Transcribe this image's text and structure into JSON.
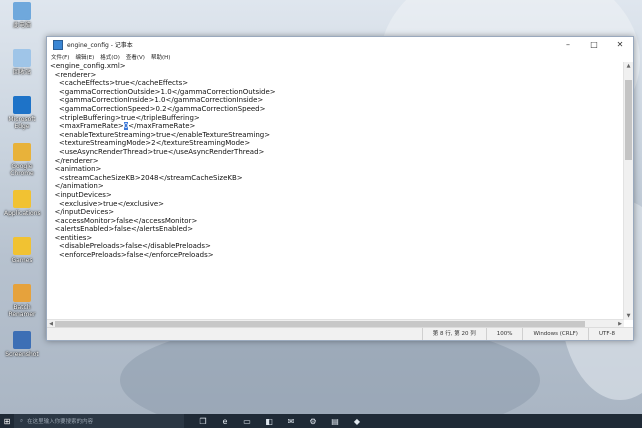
{
  "desktop": {
    "icons": [
      {
        "label": "此电脑",
        "icon": "computer-icon",
        "color": "#6fa8dc"
      },
      {
        "label": "回收站",
        "icon": "recycle-bin-icon",
        "color": "#9fc5e8"
      },
      {
        "label": "Microsoft Edge",
        "icon": "edge-icon",
        "color": "#1e73c8"
      },
      {
        "label": "Google Chrome",
        "icon": "chrome-icon",
        "color": "#e8b23a"
      },
      {
        "label": "Applications",
        "icon": "folder-icon",
        "color": "#f1c232"
      },
      {
        "label": "Games",
        "icon": "folder-icon",
        "color": "#f1c232"
      },
      {
        "label": "Batch Renamer",
        "icon": "folder-icon",
        "color": "#e6a23c"
      },
      {
        "label": "Screenshot",
        "icon": "screenshot-icon",
        "color": "#3d6fb5"
      }
    ]
  },
  "window": {
    "title": "engine_config - 记事本",
    "menu": [
      "文件(F)",
      "编辑(E)",
      "格式(O)",
      "查看(V)",
      "帮助(H)"
    ],
    "lines": [
      "<engine_config.xml>",
      "  <renderer>",
      "    <cacheEffects>true</cacheEffects>",
      "    <gammaCorrectionOutside>1.0</gammaCorrectionOutside>",
      "    <gammaCorrectionInside>1.0</gammaCorrectionInside>",
      "    <gammaCorrectionSpeed>0.2</gammaCorrectionSpeed>",
      "    <tripleBuffering>true</tripleBuffering>",
      "CURSOR_LINE",
      "    <enableTextureStreaming>true</enableTextureStreaming>",
      "    <textureStreamingMode>2</textureStreamingMode>",
      "    <useAsyncRenderThread>true</useAsyncRenderThread>",
      "  </renderer>",
      "  <animation>",
      "    <streamCacheSizeKB>2048</streamCacheSizeKB>",
      "  </animation>",
      "  <inputDevices>",
      "    <exclusive>true</exclusive>",
      "  </inputDevices>",
      "  <accessMonitor>false</accessMonitor>",
      "  <alertsEnabled>false</alertsEnabled>",
      "  <entities>",
      "    <disablePreloads>false</disablePreloads>",
      "    <enforcePreloads>false</enforcePreloads>"
    ],
    "cursor_line": {
      "before": "    <maxFrameRate>",
      "selected": "0",
      "after": "</maxFrameRate>"
    },
    "status": {
      "position": "第 8 行, 第 20 列",
      "zoom": "100%",
      "line_ending": "Windows (CRLF)",
      "encoding": "UTF-8"
    }
  },
  "taskbar": {
    "search_placeholder": "在这里输入你要搜索的内容",
    "apps": [
      "task-view-icon",
      "edge-icon",
      "file-explorer-icon",
      "store-icon",
      "mail-icon",
      "settings-icon",
      "notepad-icon",
      "app-icon"
    ]
  }
}
